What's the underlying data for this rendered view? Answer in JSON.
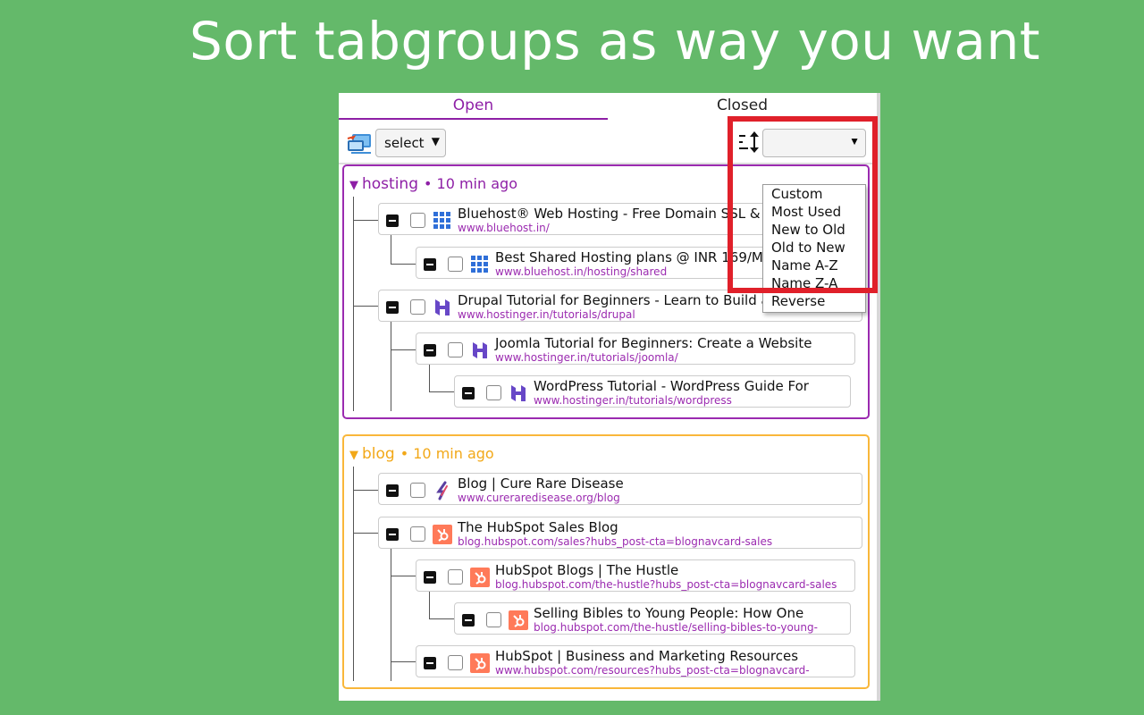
{
  "headline": "Sort tabgroups as way you want",
  "tabs": {
    "open": "Open",
    "closed": "Closed"
  },
  "toolbar": {
    "select_label": "select",
    "sort_selected": "",
    "sort_options": [
      "Custom",
      "Most Used",
      "New to Old",
      "Old to New",
      "Name A-Z",
      "Name Z-A",
      "Reverse"
    ]
  },
  "groups": [
    {
      "name": "hosting",
      "time": "• 10 min ago",
      "color": "#9b2bb0",
      "rows": [
        {
          "title": "Bluehost® Web Hosting - Free Domain SSL & SE",
          "url": "www.bluehost.in/",
          "icon": "bluehost-grid-icon"
        },
        {
          "title": "Best Shared Hosting plans @ INR 169/Mo",
          "url": "www.bluehost.in/hosting/shared",
          "icon": "bluehost-grid-icon"
        },
        {
          "title": "Drupal Tutorial for Beginners - Learn to Build a Drupal",
          "url": "www.hostinger.in/tutorials/drupal",
          "icon": "hostinger-h-icon"
        },
        {
          "title": "Joomla Tutorial for Beginners: Create a Website",
          "url": "www.hostinger.in/tutorials/joomla/",
          "icon": "hostinger-h-icon"
        },
        {
          "title": "WordPress Tutorial - WordPress Guide For",
          "url": "www.hostinger.in/tutorials/wordpress",
          "icon": "hostinger-h-icon"
        }
      ]
    },
    {
      "name": "blog",
      "time": "• 10 min ago",
      "color": "#f9b73a",
      "rows": [
        {
          "title": "Blog | Cure Rare Disease",
          "url": "www.cureraredisease.org/blog",
          "icon": "cure-rare-disease-icon"
        },
        {
          "title": "The HubSpot Sales Blog",
          "url": "blog.hubspot.com/sales?hubs_post-cta=blognavcard-sales",
          "icon": "hubspot-icon"
        },
        {
          "title": "HubSpot Blogs | The Hustle",
          "url": "blog.hubspot.com/the-hustle?hubs_post-cta=blognavcard-sales",
          "icon": "hubspot-icon"
        },
        {
          "title": "Selling Bibles to Young People: How One",
          "url": "blog.hubspot.com/the-hustle/selling-bibles-to-young-",
          "icon": "hubspot-icon"
        },
        {
          "title": "HubSpot | Business and Marketing Resources",
          "url": "www.hubspot.com/resources?hubs_post-cta=blognavcard-",
          "icon": "hubspot-icon"
        }
      ]
    }
  ]
}
